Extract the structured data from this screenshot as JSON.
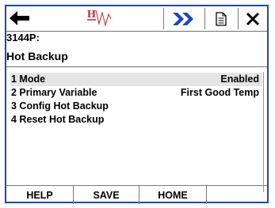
{
  "toolbar": {
    "back_icon": "left-arrow-icon",
    "logo_icon": "hart-logo-icon",
    "next_icon": "double-chevron-right-icon",
    "document_icon": "document-icon",
    "close_icon": "close-x-icon",
    "accent_color": "#1f47b4",
    "logo_color": "#c0272d"
  },
  "device": {
    "tag": "3144P:",
    "screen_title": "Hot Backup"
  },
  "menu": {
    "items": [
      {
        "label": "1 Mode",
        "value": "Enabled",
        "selected": true
      },
      {
        "label": "2 Primary Variable",
        "value": "First Good Temp"
      },
      {
        "label": "3 Config Hot Backup",
        "value": ""
      },
      {
        "label": "4 Reset Hot Backup",
        "value": ""
      }
    ]
  },
  "footer": {
    "help_label": "HELP",
    "save_label": "SAVE",
    "home_label": "HOME"
  }
}
